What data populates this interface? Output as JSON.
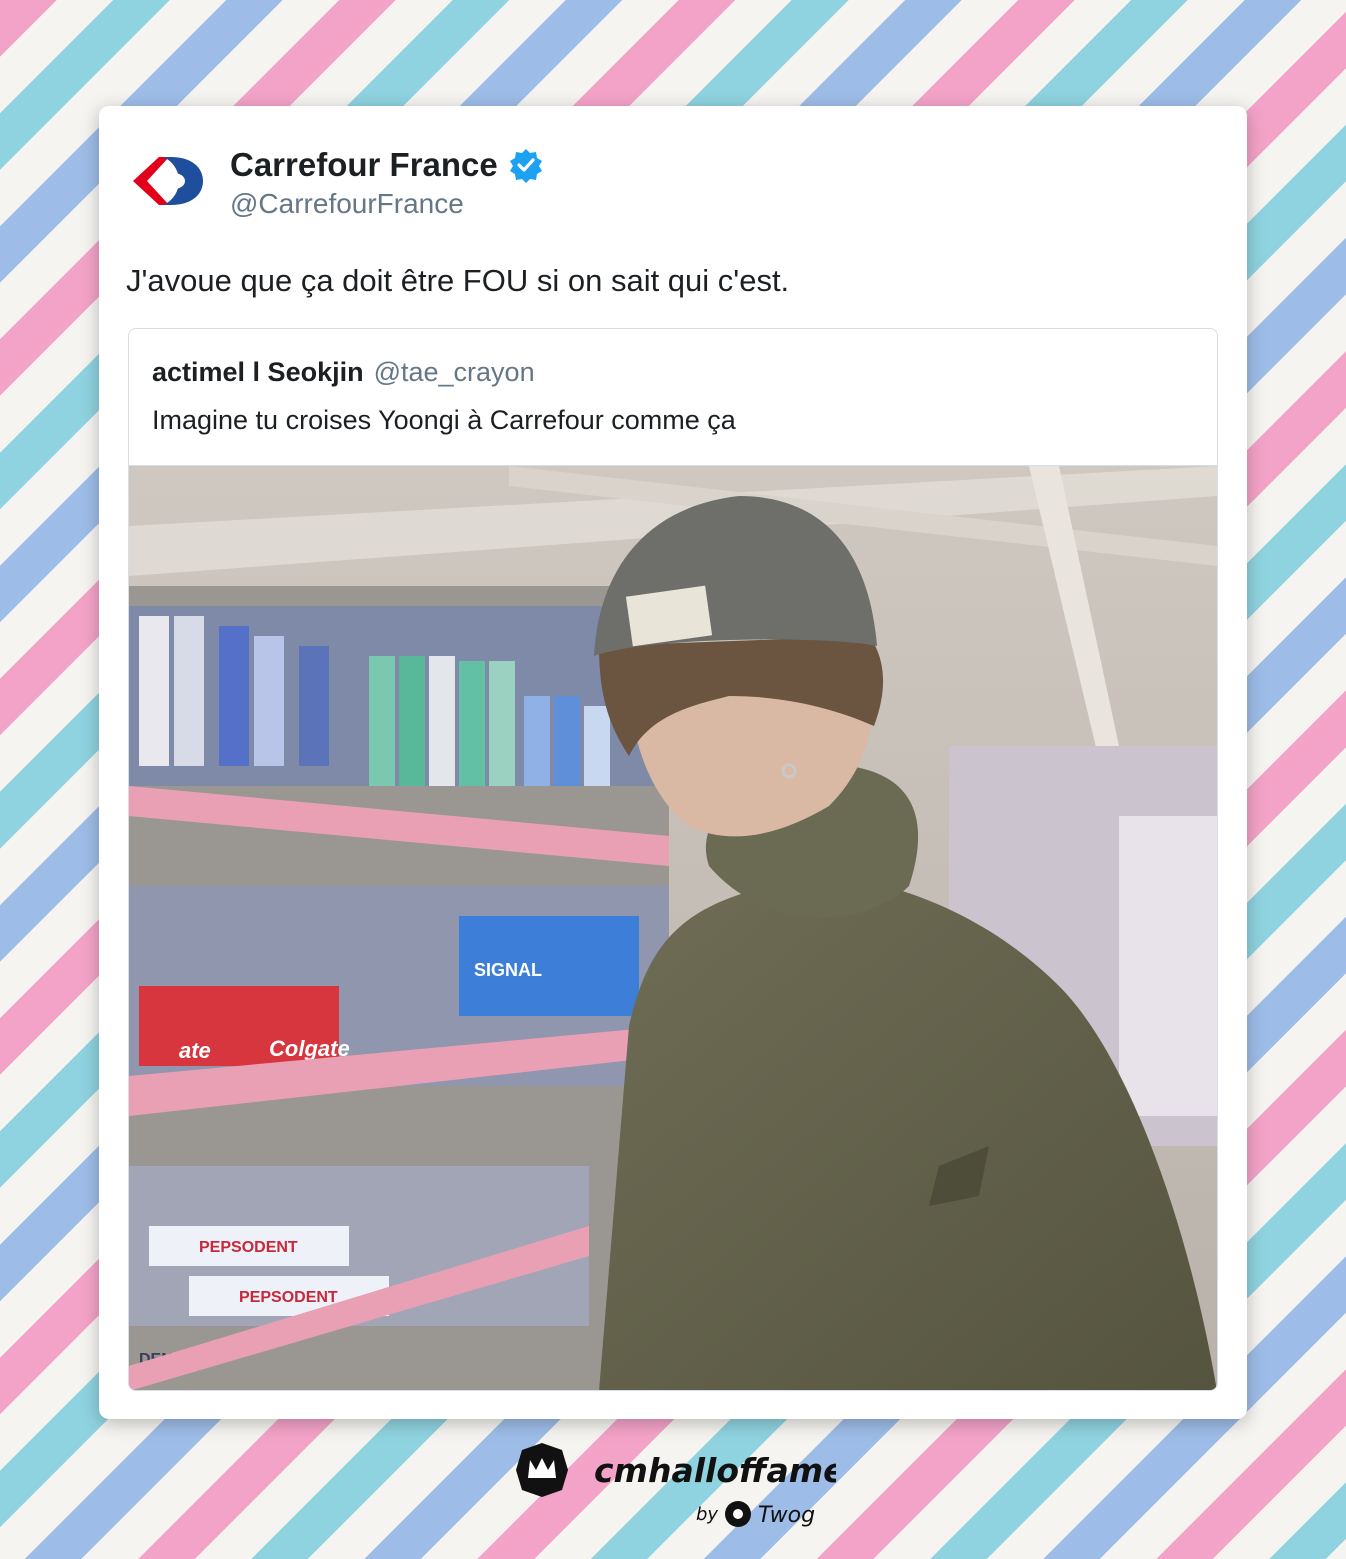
{
  "tweet": {
    "display_name": "Carrefour France",
    "handle": "@CarrefourFrance",
    "text": "J'avoue que ça doit être FOU si on sait qui c'est.",
    "verified": true
  },
  "quoted_tweet": {
    "display_name": "actimel l Seokjin",
    "handle": "@tae_crayon",
    "text": "Imagine tu croises Yoongi à Carrefour comme ça"
  },
  "photo": {
    "shelf_labels": [
      "Colgate",
      "ate",
      "SIGNAL",
      "PEPSODENT",
      "PEPSODENT",
      "DENT"
    ]
  },
  "footer": {
    "site": "cmhalloffame.fr",
    "by_label": "by",
    "brand": "Twog"
  },
  "colors": {
    "carrefour_red": "#e2001a",
    "carrefour_blue": "#1f4e9c",
    "verified_blue": "#1da1f2",
    "stripe_pink": "#f4a3c8",
    "stripe_cyan": "#8fd3e0",
    "stripe_blue": "#9dbde8"
  }
}
